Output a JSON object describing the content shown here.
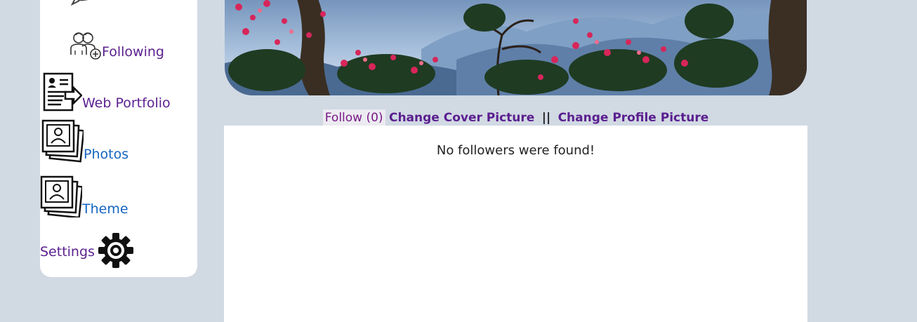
{
  "sidebar": {
    "items": [
      {
        "label": "Following",
        "icon": "following-icon"
      },
      {
        "label": "Web Portfolio",
        "icon": "resume-icon"
      },
      {
        "label": "Photos",
        "icon": "photos-icon"
      },
      {
        "label": "Theme",
        "icon": "theme-icon"
      },
      {
        "label": "Settings",
        "icon": "gear-icon"
      }
    ]
  },
  "actions": {
    "follow": "Follow (0)",
    "change_cover": "Change Cover Picture",
    "separator": "||",
    "change_profile": "Change Profile Picture"
  },
  "main": {
    "empty_message": "No followers were found!"
  },
  "colors": {
    "background": "#d1d9e3",
    "link_purple": "#5a1f8f",
    "link_blue": "#1565c0"
  }
}
